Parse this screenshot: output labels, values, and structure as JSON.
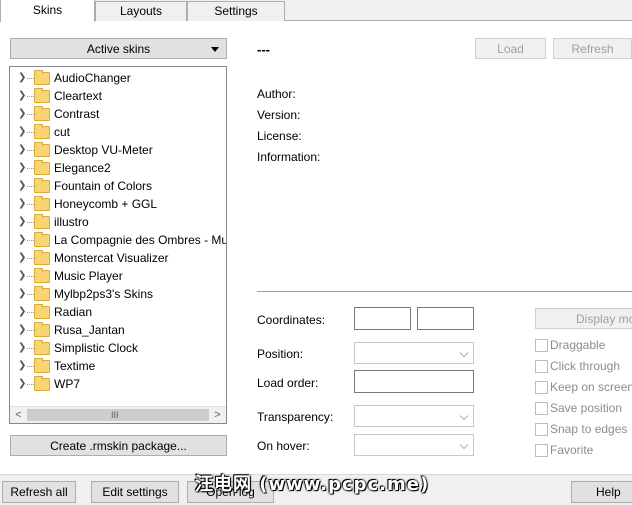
{
  "tabs": [
    {
      "label": "Skins"
    },
    {
      "label": "Layouts"
    },
    {
      "label": "Settings"
    }
  ],
  "skins_panel": {
    "dropdown_label": "Active skins",
    "tree_items": [
      "AudioChanger",
      "Cleartext",
      "Contrast",
      "cut",
      "Desktop VU-Meter",
      "Elegance2",
      "Fountain of Colors",
      "Honeycomb + GGL",
      "illustro",
      "La Compagnie des Ombres - Mu",
      "Monstercat Visualizer",
      "Music Player",
      "Mylbp2ps3's Skins",
      "Radian",
      "Rusa_Jantan",
      "Simplistic Clock",
      "Textime",
      "WP7"
    ],
    "scroll_grip": "III",
    "create_button": "Create .rmskin package..."
  },
  "details": {
    "skin_title": "---",
    "load_button": "Load",
    "refresh_button": "Refresh",
    "author_label": "Author:",
    "version_label": "Version:",
    "license_label": "License:",
    "information_label": "Information:"
  },
  "settings_form": {
    "coordinates_label": "Coordinates:",
    "position_label": "Position:",
    "load_order_label": "Load order:",
    "transparency_label": "Transparency:",
    "on_hover_label": "On hover:",
    "display_button": "Display mo",
    "checkboxes": [
      {
        "label": "Draggable",
        "checked": false
      },
      {
        "label": "Click through",
        "checked": false
      },
      {
        "label": "Keep on screen",
        "checked": false
      },
      {
        "label": "Save position",
        "checked": false
      },
      {
        "label": "Snap to edges",
        "checked": false
      },
      {
        "label": "Favorite",
        "checked": false
      }
    ]
  },
  "bottom": {
    "refresh_all": "Refresh all",
    "edit_settings": "Edit settings",
    "open_log": "Open log",
    "help": "Help"
  },
  "watermark": "汪电网 (www.pcpc.me)"
}
